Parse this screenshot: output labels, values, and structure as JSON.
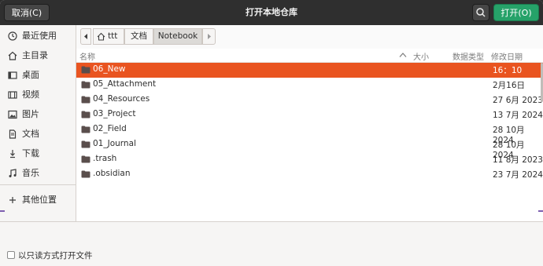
{
  "titlebar": {
    "cancel_label": "取消(C)",
    "title": "打开本地仓库",
    "search_icon": "search-icon",
    "open_label": "打开(O)"
  },
  "sidebar": {
    "items": [
      {
        "label": "最近使用",
        "icon": "clock-icon"
      },
      {
        "label": "主目录",
        "icon": "home-icon"
      },
      {
        "label": "桌面",
        "icon": "desktop-icon"
      },
      {
        "label": "视频",
        "icon": "video-icon"
      },
      {
        "label": "图片",
        "icon": "image-icon"
      },
      {
        "label": "文档",
        "icon": "document-icon"
      },
      {
        "label": "下载",
        "icon": "download-icon"
      },
      {
        "label": "音乐",
        "icon": "music-icon"
      }
    ],
    "other_label": "其他位置",
    "other_icon": "plus-icon"
  },
  "pathbar": {
    "back_icon": "chevron-left-icon",
    "crumbs": [
      "ttt",
      "文档",
      "Notebook"
    ],
    "home_icon": "home-icon",
    "forward_icon": "chevron-right-icon"
  },
  "columns": {
    "name": "名称",
    "size": "大小",
    "type": "数据类型",
    "modified": "修改日期",
    "sort_icon": "chevron-up-icon"
  },
  "files": [
    {
      "name": "06_New",
      "date": "16：10",
      "selected": true
    },
    {
      "name": "05_Attachment",
      "date": "2月16日"
    },
    {
      "name": "04_Resources",
      "date": "27 6月 2023"
    },
    {
      "name": "03_Project",
      "date": "13 7月 2024"
    },
    {
      "name": "02_Field",
      "date": "28 10月 2024"
    },
    {
      "name": "01_Journal",
      "date": "28 10月 2024"
    },
    {
      "name": ".trash",
      "date": "11 8月 2023"
    },
    {
      "name": ".obsidian",
      "date": "23 7月 2024"
    }
  ],
  "footer": {
    "readonly_label": "以只读方式打开文件"
  },
  "colors": {
    "accent": "#e95420",
    "open_button": "#26a269",
    "titlebar": "#2f2f2f"
  }
}
